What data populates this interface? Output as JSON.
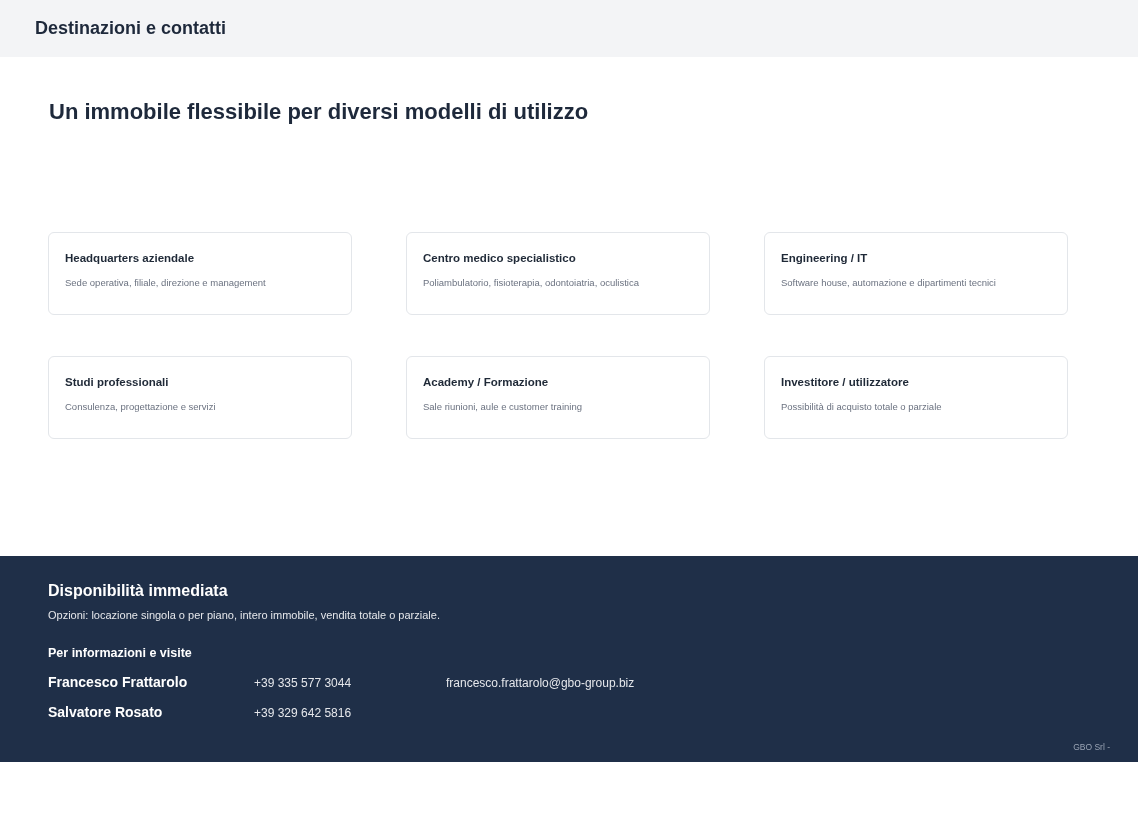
{
  "header": {
    "title": "Destinazioni e contatti"
  },
  "heading": "Un immobile flessibile per diversi modelli di utilizzo",
  "cards": [
    {
      "title": "Headquarters aziendale",
      "text": "Sede operativa, filiale, direzione e management"
    },
    {
      "title": "Centro medico specialistico",
      "text": "Poliambulatorio, fisioterapia, odontoiatria, oculistica"
    },
    {
      "title": "Engineering / IT",
      "text": "Software house, automazione e dipartimenti tecnici"
    },
    {
      "title": "Studi professionali",
      "text": "Consulenza, progettazione e servizi"
    },
    {
      "title": "Academy / Formazione",
      "text": "Sale riunioni, aule e customer training"
    },
    {
      "title": "Investitore / utilizzatore",
      "text": "Possibilità di acquisto totale o parziale"
    }
  ],
  "footer": {
    "title": "Disponibilità immediata",
    "options": "Opzioni: locazione singola o per piano, intero immobile, vendita totale o parziale.",
    "contacts_heading": "Per informazioni e visite",
    "contacts": [
      {
        "name": "Francesco Frattarolo",
        "phone": "+39 335 577 3044",
        "email": "francesco.frattarolo@gbo-group.biz"
      },
      {
        "name": "Salvatore Rosato",
        "phone": "+39 329 642 5816"
      }
    ],
    "company": "GBO Srl -"
  }
}
